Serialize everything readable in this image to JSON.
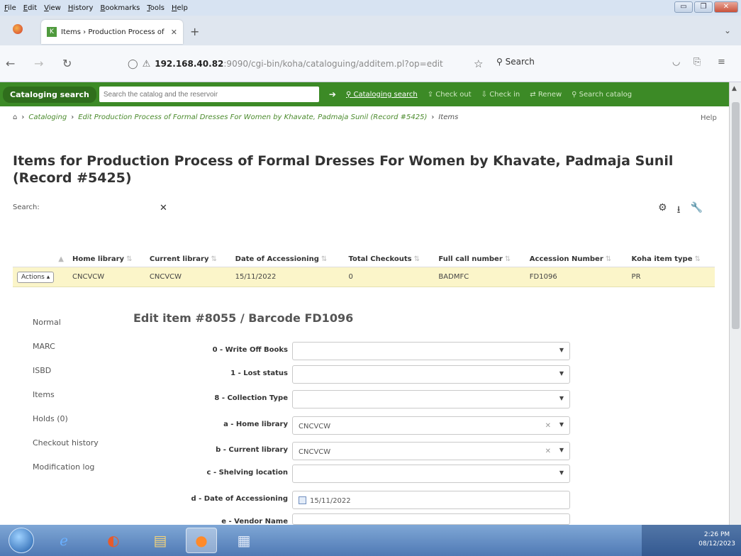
{
  "browser": {
    "menu": [
      "File",
      "Edit",
      "View",
      "History",
      "Bookmarks",
      "Tools",
      "Help"
    ],
    "tab_title": "Items › Production Process of",
    "url_host": "192.168.40.82",
    "url_rest": ":9090/cgi-bin/koha/cataloguing/additem.pl?op=edit",
    "search_label": "Search"
  },
  "koha_bar": {
    "cataloging_search": "Cataloging search",
    "placeholder": "Search the catalog and the reservoir",
    "links": [
      "Cataloging search",
      "Check out",
      "Check in",
      "Renew",
      "Search catalog"
    ]
  },
  "breadcrumb": {
    "cataloging": "Cataloging",
    "record": "Edit Production Process of Formal Dresses For Women by Khavate, Padmaja Sunil (Record #5425)",
    "current": "Items",
    "help": "Help"
  },
  "page_title": "Items for Production Process of Formal Dresses For Women by Khavate, Padmaja Sunil (Record #5425)",
  "table": {
    "search_label": "Search:",
    "headers": [
      "Home library",
      "Current library",
      "Date of Accessioning",
      "Total Checkouts",
      "Full call number",
      "Accession Number",
      "Koha item type"
    ],
    "actions_label": "Actions",
    "row": [
      "CNCVCW",
      "CNCVCW",
      "15/11/2022",
      "0",
      "BADMFC",
      "FD1096",
      "PR"
    ]
  },
  "left_nav": [
    "Normal",
    "MARC",
    "ISBD",
    "Items",
    "Holds (0)",
    "Checkout history",
    "Modification log"
  ],
  "edit_title": "Edit item #8055 / Barcode FD1096",
  "form": [
    {
      "label": "0 - Write Off Books",
      "value": ""
    },
    {
      "label": "1 - Lost status",
      "value": ""
    },
    {
      "label": "8 - Collection Type",
      "value": ""
    },
    {
      "label": "a - Home library",
      "value": "CNCVCW"
    },
    {
      "label": "b - Current library",
      "value": "CNCVCW"
    },
    {
      "label": "c - Shelving location",
      "value": ""
    },
    {
      "label": "d - Date of Accessioning",
      "value": "15/11/2022"
    },
    {
      "label": "e - Vendor Name",
      "value": ""
    }
  ],
  "taskbar": {
    "time": "2:26 PM",
    "date": "08/12/2023"
  }
}
